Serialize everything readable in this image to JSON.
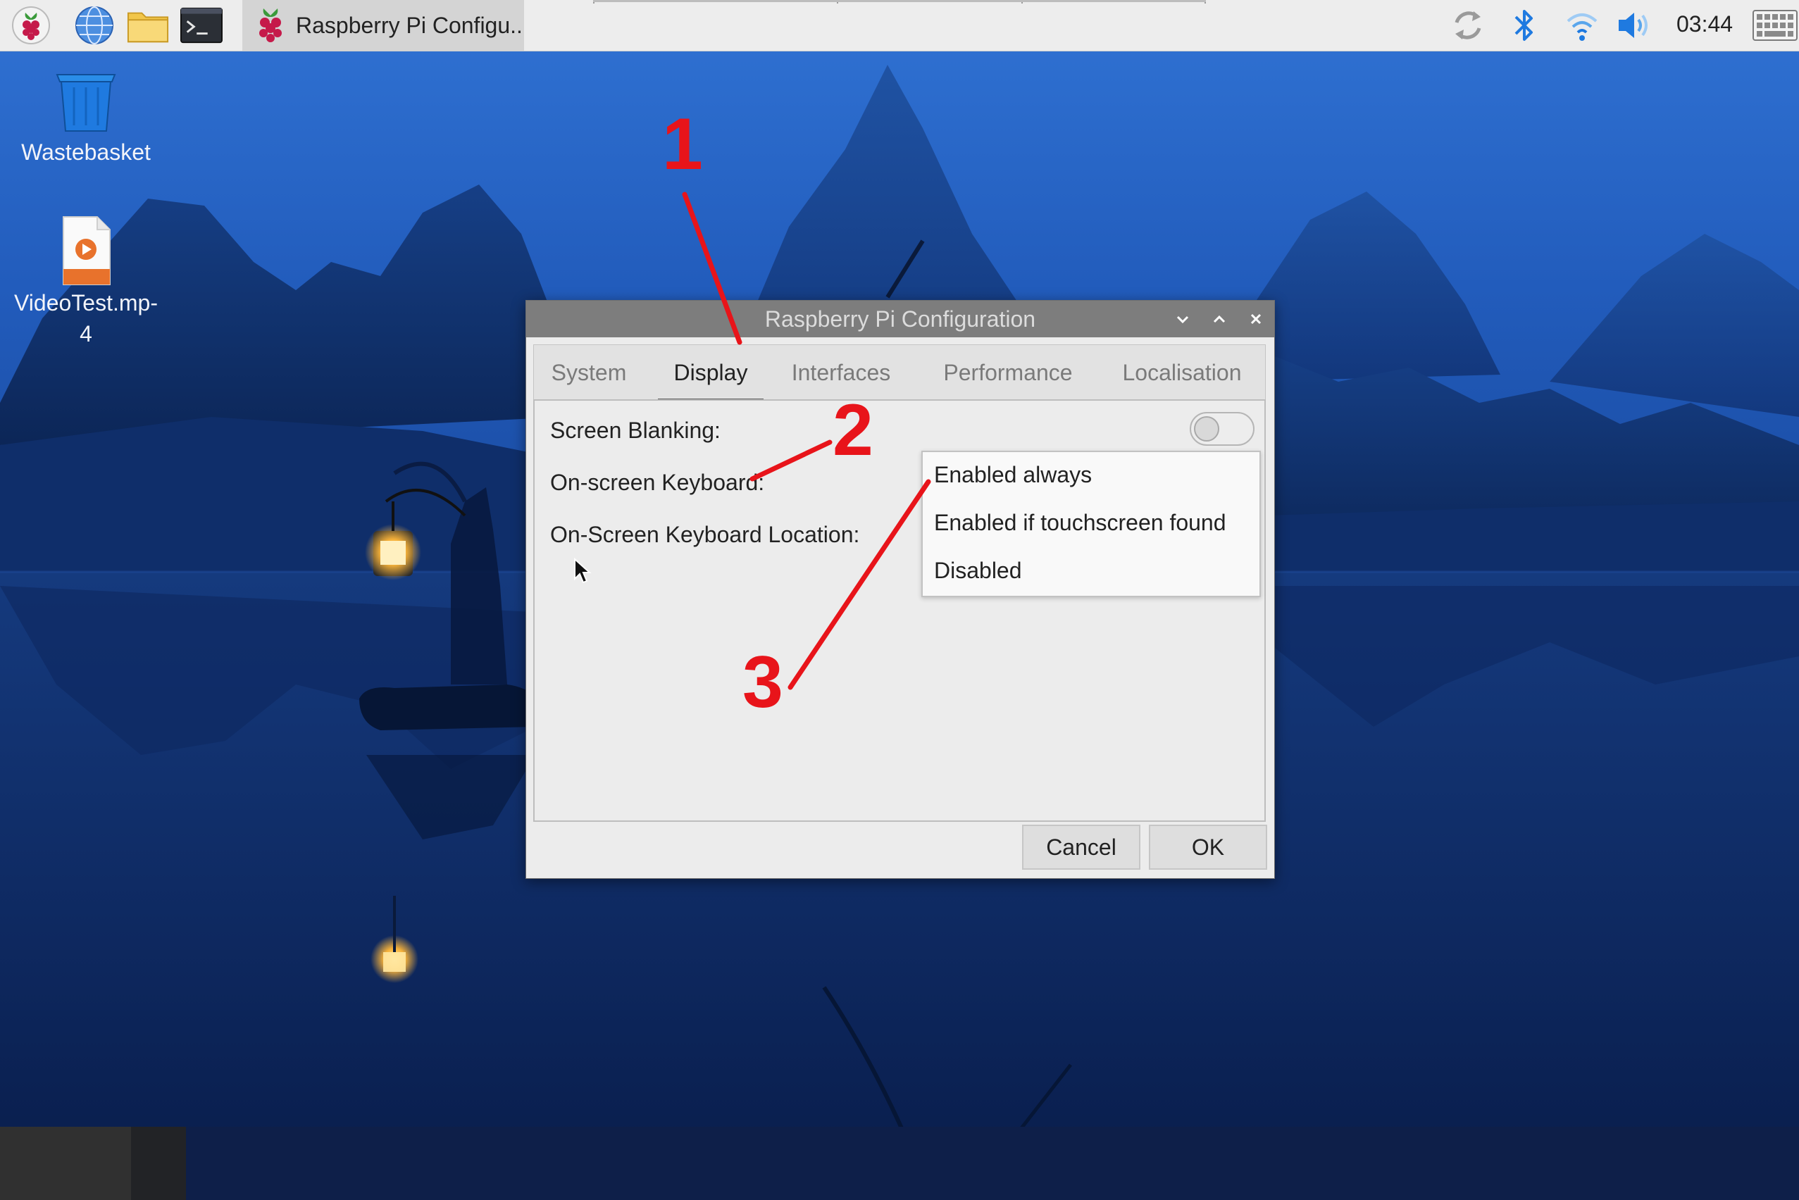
{
  "taskbar": {
    "window_title": "Raspberry Pi Configu..",
    "clock": "03:44",
    "launchers": [
      "raspberry-menu-icon",
      "web-browser-icon",
      "file-manager-icon",
      "terminal-icon"
    ],
    "tray_icons": [
      "update-sync-icon",
      "bluetooth-icon",
      "wifi-icon",
      "volume-icon",
      "keyboard-icon"
    ]
  },
  "desktop": {
    "icons": [
      {
        "label": "Wastebasket",
        "icon": "wastebasket-icon"
      },
      {
        "label_line1": "VideoTest.mp-",
        "label_line2": "4",
        "icon": "video-file-icon"
      }
    ]
  },
  "dialog": {
    "title": "Raspberry Pi Configuration",
    "tabs": [
      "System",
      "Display",
      "Interfaces",
      "Performance",
      "Localisation"
    ],
    "active_tab": "Display",
    "rows": {
      "screen_blanking": "Screen Blanking:",
      "onscreen_keyboard": "On-screen Keyboard:",
      "onscreen_keyboard_location": "On-Screen Keyboard Location:"
    },
    "screen_blanking_enabled": false,
    "keyboard_options": [
      "Enabled always",
      "Enabled if touchscreen found",
      "Disabled"
    ],
    "buttons": {
      "cancel": "Cancel",
      "ok": "OK"
    }
  },
  "annotations": [
    "1",
    "2",
    "3"
  ],
  "colors": {
    "annotation": "#e8141a",
    "titlebar": "#7d7d7d",
    "dialog_bg": "#ececec",
    "taskbar_bg": "#ededed",
    "accent_blue": "#1f7ae0"
  }
}
